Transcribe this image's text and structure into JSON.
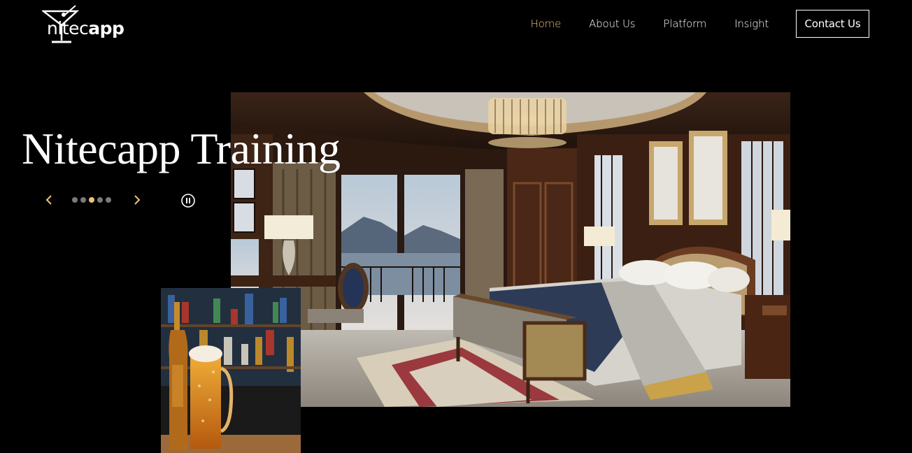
{
  "logo": {
    "text_light": "nitec",
    "text_bold": "app"
  },
  "nav": {
    "items": [
      {
        "label": "Home",
        "active": true
      },
      {
        "label": "About Us",
        "active": false
      },
      {
        "label": "Platform",
        "active": false
      },
      {
        "label": "Insight",
        "active": false
      }
    ],
    "contact_label": "Contact Us"
  },
  "hero": {
    "title": "Nitecapp Training",
    "slides_total": 5,
    "active_slide": 3
  },
  "colors": {
    "accent": "#f0c27a",
    "background": "#000000"
  },
  "icons": [
    "martini-glass-icon",
    "chevron-left-icon",
    "chevron-right-icon",
    "pause-icon"
  ]
}
